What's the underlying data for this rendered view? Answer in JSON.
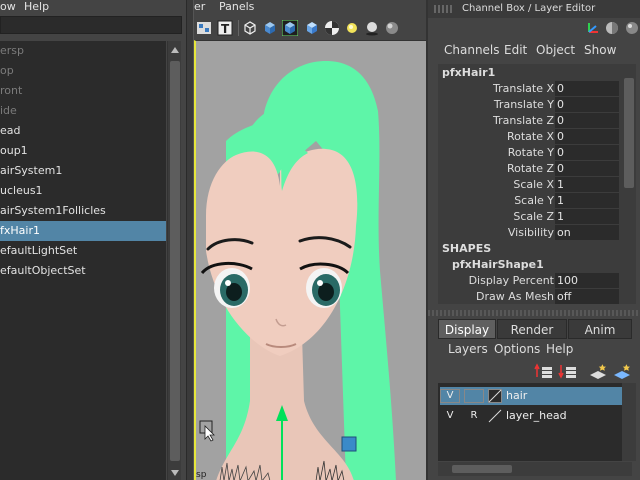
{
  "outliner": {
    "menu": [
      "ow",
      "Help"
    ],
    "items": [
      {
        "label": "ersp",
        "dim": true
      },
      {
        "label": "op",
        "dim": true
      },
      {
        "label": "ront",
        "dim": true
      },
      {
        "label": "ide",
        "dim": true
      },
      {
        "label": "ead",
        "dim": false
      },
      {
        "label": "oup1",
        "dim": false
      },
      {
        "label": "airSystem1",
        "dim": false
      },
      {
        "label": "ucleus1",
        "dim": false
      },
      {
        "label": "airSystem1Follicles",
        "dim": false
      },
      {
        "label": "fxHair1",
        "dim": false,
        "selected": true
      },
      {
        "label": "efaultLightSet",
        "dim": false
      },
      {
        "label": "efaultObjectSet",
        "dim": false
      }
    ]
  },
  "viewport": {
    "menu": [
      "er",
      "Panels"
    ],
    "camera_label": "sp",
    "colors": {
      "hair": "#5ef5a8",
      "skin": "#f0cdbf",
      "background": "#a2a2a2",
      "manip": "#00e05a"
    }
  },
  "channel_box": {
    "title": "Channel Box / Layer Editor",
    "menu": [
      "Channels",
      "Edit",
      "Object",
      "Show"
    ],
    "node": "pfxHair1",
    "attributes": [
      {
        "label": "Translate X",
        "value": "0"
      },
      {
        "label": "Translate Y",
        "value": "0"
      },
      {
        "label": "Translate Z",
        "value": "0"
      },
      {
        "label": "Rotate X",
        "value": "0"
      },
      {
        "label": "Rotate Y",
        "value": "0"
      },
      {
        "label": "Rotate Z",
        "value": "0"
      },
      {
        "label": "Scale X",
        "value": "1"
      },
      {
        "label": "Scale Y",
        "value": "1"
      },
      {
        "label": "Scale Z",
        "value": "1"
      },
      {
        "label": "Visibility",
        "value": "on"
      }
    ],
    "shapes_header": "SHAPES",
    "shape_node": "pfxHairShape1",
    "shape_attributes": [
      {
        "label": "Display Percent",
        "value": "100"
      },
      {
        "label": "Draw As Mesh",
        "value": "off"
      }
    ]
  },
  "layer_editor": {
    "tabs": [
      {
        "label": "Display",
        "active": true
      },
      {
        "label": "Render",
        "active": false
      },
      {
        "label": "Anim",
        "active": false
      }
    ],
    "menu": [
      "Layers",
      "Options",
      "Help"
    ],
    "layers": [
      {
        "v": "V",
        "r": "",
        "name": "hair",
        "selected": true
      },
      {
        "v": "V",
        "r": "R",
        "name": "layer_head",
        "selected": false
      }
    ]
  }
}
